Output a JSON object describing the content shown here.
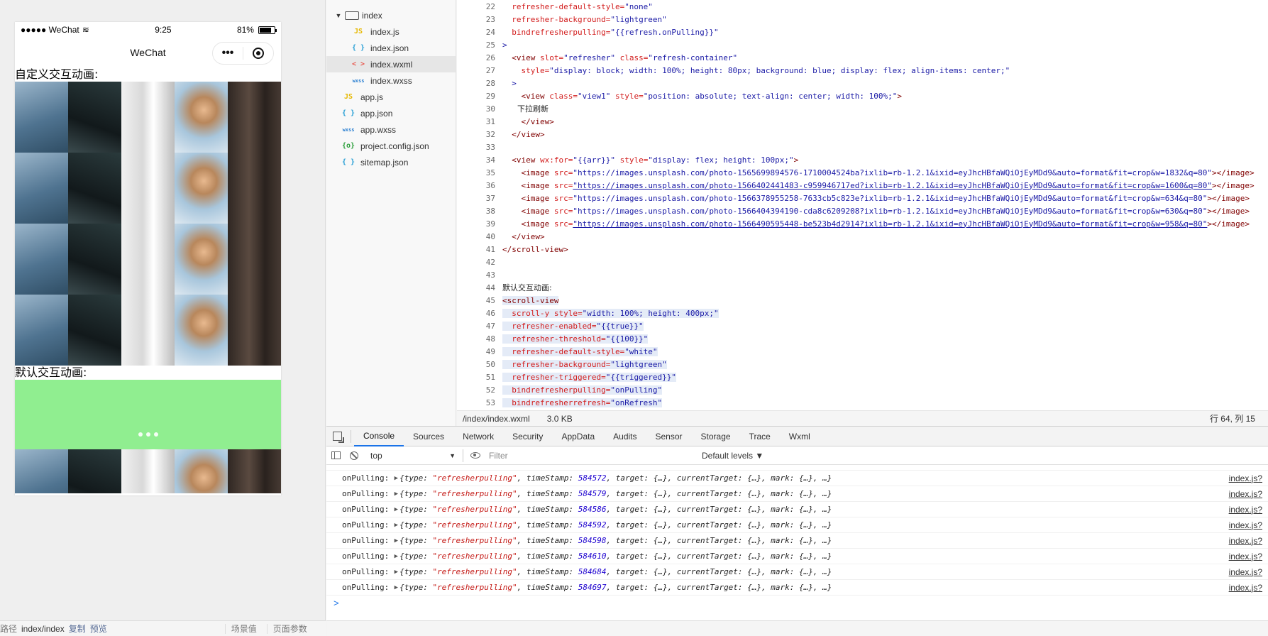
{
  "simulator": {
    "status": {
      "signal": "●●●●● WeChat",
      "time": "9:25",
      "battery_pct": "81%",
      "battery_level": 0.81
    },
    "nav_title": "WeChat",
    "capsule_more": "•••",
    "section1_label": "自定义交互动画:",
    "section2_label": "默认交互动画:",
    "footer": {
      "path_label": "路径",
      "path": "index/index",
      "copy": "复制",
      "preview": "预览",
      "scene": "场景值",
      "params": "页面参数"
    }
  },
  "file_tree": {
    "items": [
      {
        "name": "index",
        "icon": "folder-icon",
        "type": "folder"
      },
      {
        "name": "index.js",
        "icon": "js-file-icon",
        "glyph": "JS"
      },
      {
        "name": "index.json",
        "icon": "json-file-icon",
        "glyph": "{ }"
      },
      {
        "name": "index.wxml",
        "icon": "wxml-file-icon",
        "glyph": "< >"
      },
      {
        "name": "index.wxss",
        "icon": "wxss-file-icon",
        "glyph": "wxss"
      },
      {
        "name": "app.js",
        "icon": "js-file-icon",
        "glyph": "JS"
      },
      {
        "name": "app.json",
        "icon": "json-file-icon",
        "glyph": "{ }"
      },
      {
        "name": "app.wxss",
        "icon": "wxss-file-icon",
        "glyph": "wxss"
      },
      {
        "name": "project.config.json",
        "icon": "config-file-icon",
        "glyph": "{o}"
      },
      {
        "name": "sitemap.json",
        "icon": "json-file-icon",
        "glyph": "{ }"
      }
    ]
  },
  "editor": {
    "lines": [
      {
        "n": "22",
        "parts": [
          {
            "t": "  refresher-default-style=",
            "c": "attr"
          },
          {
            "t": "\"none\"",
            "c": "str"
          }
        ]
      },
      {
        "n": "23",
        "parts": [
          {
            "t": "  refresher-background=",
            "c": "attr"
          },
          {
            "t": "\"lightgreen\"",
            "c": "str"
          }
        ]
      },
      {
        "n": "24",
        "parts": [
          {
            "t": "  bindrefresherpulling=",
            "c": "attr"
          },
          {
            "t": "\"{{refresh.onPulling}}\"",
            "c": "str"
          }
        ]
      },
      {
        "n": "25",
        "parts": [
          {
            "t": ">",
            "c": "str"
          }
        ]
      },
      {
        "n": "26",
        "parts": [
          {
            "t": "  <view ",
            "c": "tag"
          },
          {
            "t": "slot=",
            "c": "attr"
          },
          {
            "t": "\"refresher\" ",
            "c": "str"
          },
          {
            "t": "class=",
            "c": "attr"
          },
          {
            "t": "\"refresh-container\"",
            "c": "str"
          }
        ]
      },
      {
        "n": "27",
        "parts": [
          {
            "t": "    style=",
            "c": "attr"
          },
          {
            "t": "\"display: block; width: 100%; height: 80px; background: blue; display: flex; align-items: center;\"",
            "c": "str"
          }
        ]
      },
      {
        "n": "28",
        "parts": [
          {
            "t": "  >",
            "c": "str"
          }
        ]
      },
      {
        "n": "29",
        "parts": [
          {
            "t": "    <view ",
            "c": "tag"
          },
          {
            "t": "class=",
            "c": "attr"
          },
          {
            "t": "\"view1\" ",
            "c": "str"
          },
          {
            "t": "style=",
            "c": "attr"
          },
          {
            "t": "\"position: absolute; text-align: center; width: 100%;\"",
            "c": "str"
          },
          {
            "t": ">",
            "c": "tag"
          }
        ]
      },
      {
        "n": "30",
        "parts": [
          {
            "t": "      下拉刷新",
            "c": "txt"
          }
        ]
      },
      {
        "n": "31",
        "parts": [
          {
            "t": "    </view>",
            "c": "tag"
          }
        ]
      },
      {
        "n": "32",
        "parts": [
          {
            "t": "  </view>",
            "c": "tag"
          }
        ]
      },
      {
        "n": "33",
        "parts": [
          {
            "t": "",
            "c": "txt"
          }
        ]
      },
      {
        "n": "34",
        "parts": [
          {
            "t": "  <view ",
            "c": "tag"
          },
          {
            "t": "wx:for=",
            "c": "attr"
          },
          {
            "t": "\"{{arr}}\" ",
            "c": "str"
          },
          {
            "t": "style=",
            "c": "attr"
          },
          {
            "t": "\"display: flex; height: 100px;\"",
            "c": "str"
          },
          {
            "t": ">",
            "c": "tag"
          }
        ]
      },
      {
        "n": "35",
        "parts": [
          {
            "t": "    <image ",
            "c": "tag"
          },
          {
            "t": "src=",
            "c": "attr"
          },
          {
            "t": "\"https://images.unsplash.com/photo-1565699894576-1710004524ba?ixlib=rb-1.2.1&ixid=eyJhcHBfaWQiOjEyMDd9&auto=format&fit=crop&w=1832&q=80\"",
            "c": "str"
          },
          {
            "t": "></image>",
            "c": "tag"
          }
        ]
      },
      {
        "n": "36",
        "parts": [
          {
            "t": "    <image ",
            "c": "tag"
          },
          {
            "t": "src=",
            "c": "attr"
          },
          {
            "t": "\"https://images.unsplash.com/photo-1566402441483-c959946717ed?ixlib=rb-1.2.1&ixid=eyJhcHBfaWQiOjEyMDd9&auto=format&fit=crop&w=1600&q=80\"",
            "c": "link"
          },
          {
            "t": "></image>",
            "c": "tag"
          }
        ]
      },
      {
        "n": "37",
        "parts": [
          {
            "t": "    <image ",
            "c": "tag"
          },
          {
            "t": "src=",
            "c": "attr"
          },
          {
            "t": "\"https://images.unsplash.com/photo-1566378955258-7633cb5c823e?ixlib=rb-1.2.1&ixid=eyJhcHBfaWQiOjEyMDd9&auto=format&fit=crop&w=634&q=80\"",
            "c": "str"
          },
          {
            "t": "></image>",
            "c": "tag"
          }
        ]
      },
      {
        "n": "38",
        "parts": [
          {
            "t": "    <image ",
            "c": "tag"
          },
          {
            "t": "src=",
            "c": "attr"
          },
          {
            "t": "\"https://images.unsplash.com/photo-1566404394190-cda8c6209208?ixlib=rb-1.2.1&ixid=eyJhcHBfaWQiOjEyMDd9&auto=format&fit=crop&w=630&q=80\"",
            "c": "str"
          },
          {
            "t": "></image>",
            "c": "tag"
          }
        ]
      },
      {
        "n": "39",
        "parts": [
          {
            "t": "    <image ",
            "c": "tag"
          },
          {
            "t": "src=",
            "c": "attr"
          },
          {
            "t": "\"https://images.unsplash.com/photo-1566490595448-be523b4d2914?ixlib=rb-1.2.1&ixid=eyJhcHBfaWQiOjEyMDd9&auto=format&fit=crop&w=958&q=80\"",
            "c": "link"
          },
          {
            "t": "></image>",
            "c": "tag"
          }
        ]
      },
      {
        "n": "40",
        "parts": [
          {
            "t": "  </view>",
            "c": "tag"
          }
        ]
      },
      {
        "n": "41",
        "parts": [
          {
            "t": "</scroll-view>",
            "c": "tag"
          }
        ]
      },
      {
        "n": "42",
        "parts": [
          {
            "t": "",
            "c": "txt"
          }
        ]
      },
      {
        "n": "43",
        "parts": [
          {
            "t": "",
            "c": "txt"
          }
        ]
      },
      {
        "n": "44",
        "parts": [
          {
            "t": "默认交互动画:",
            "c": "txt"
          }
        ]
      },
      {
        "n": "45",
        "sel": true,
        "parts": [
          {
            "t": "<scroll-view",
            "c": "tag"
          }
        ]
      },
      {
        "n": "46",
        "sel": true,
        "parts": [
          {
            "t": "  scroll-y ",
            "c": "attr"
          },
          {
            "t": "style=",
            "c": "attr"
          },
          {
            "t": "\"width: 100%; height: 400px;\"",
            "c": "str"
          }
        ]
      },
      {
        "n": "47",
        "sel": true,
        "parts": [
          {
            "t": "  refresher-enabled=",
            "c": "attr"
          },
          {
            "t": "\"{{true}}\"",
            "c": "str"
          }
        ]
      },
      {
        "n": "48",
        "sel": true,
        "parts": [
          {
            "t": "  refresher-threshold=",
            "c": "attr"
          },
          {
            "t": "\"{{100}}\"",
            "c": "str"
          }
        ]
      },
      {
        "n": "49",
        "sel": true,
        "parts": [
          {
            "t": "  refresher-default-style=",
            "c": "attr"
          },
          {
            "t": "\"white\"",
            "c": "str"
          }
        ]
      },
      {
        "n": "50",
        "sel": true,
        "parts": [
          {
            "t": "  refresher-background=",
            "c": "attr"
          },
          {
            "t": "\"lightgreen\"",
            "c": "str"
          }
        ]
      },
      {
        "n": "51",
        "sel": true,
        "parts": [
          {
            "t": "  refresher-triggered=",
            "c": "attr"
          },
          {
            "t": "\"{{triggered}}\"",
            "c": "str"
          }
        ]
      },
      {
        "n": "52",
        "sel": true,
        "parts": [
          {
            "t": "  bindrefresherpulling=",
            "c": "attr"
          },
          {
            "t": "\"onPulling\"",
            "c": "str"
          }
        ]
      },
      {
        "n": "53",
        "sel": true,
        "parts": [
          {
            "t": "  bindrefresherrefresh=",
            "c": "attr"
          },
          {
            "t": "\"onRefresh\"",
            "c": "str"
          }
        ]
      }
    ],
    "status": {
      "path": "/index/index.wxml",
      "size": "3.0 KB",
      "cursor": "行 64, 列 15"
    }
  },
  "devtools": {
    "tabs": [
      "Console",
      "Sources",
      "Network",
      "Security",
      "AppData",
      "Audits",
      "Sensor",
      "Storage",
      "Trace",
      "Wxml"
    ],
    "active_tab": "Console",
    "context": "top",
    "filter_placeholder": "Filter",
    "levels": "Default levels ▼",
    "logs": [
      {
        "ts": "584572"
      },
      {
        "ts": "584579"
      },
      {
        "ts": "584586"
      },
      {
        "ts": "584592"
      },
      {
        "ts": "584598"
      },
      {
        "ts": "584610"
      },
      {
        "ts": "584684"
      },
      {
        "ts": "584697"
      }
    ],
    "log_label": "onPulling:",
    "log_type": "\"refresherpulling\"",
    "log_source": "index.js?",
    "prompt": ">"
  },
  "colors": {
    "refresher_bg": "#90ee90",
    "active_tab": "#1a73e8",
    "selected_file": "#e6e6e6"
  }
}
